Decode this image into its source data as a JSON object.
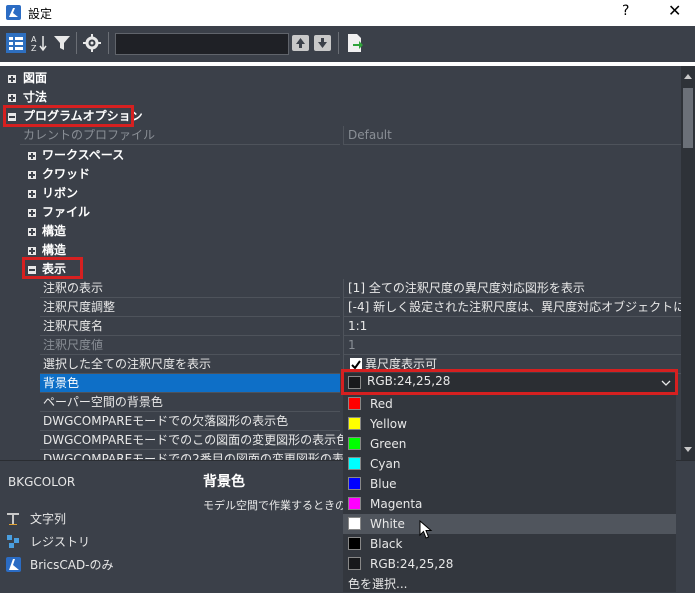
{
  "window": {
    "title": "設定",
    "help_label": "?",
    "close_label": "✕"
  },
  "toolbar": {
    "icons": [
      "categorized-view-icon",
      "sort-az-icon",
      "filter-icon",
      "settings-icon",
      "arrow-up-icon",
      "arrow-down-icon",
      "export-icon"
    ],
    "search": {
      "value": "",
      "placeholder": ""
    }
  },
  "tree": {
    "categories": [
      {
        "label": "図面",
        "expanded": false
      },
      {
        "label": "寸法",
        "expanded": false
      },
      {
        "label": "プログラムオプション",
        "expanded": true
      }
    ],
    "current_profile": {
      "name": "カレントのプロファイル",
      "value": "Default"
    },
    "subcategories": [
      {
        "label": "ワークスペース"
      },
      {
        "label": "クワッド"
      },
      {
        "label": "リボン"
      },
      {
        "label": "ファイル"
      },
      {
        "label": "構造"
      },
      {
        "label": "構造"
      },
      {
        "label": "表示"
      }
    ],
    "properties": [
      {
        "name": "注釈の表示",
        "value": "[1] 全ての注釈尺度の異尺度対応図形を表示"
      },
      {
        "name": "注釈尺度調整",
        "value": "[-4] 新しく設定された注釈尺度は、異尺度対応オブジェクトに追加されます"
      },
      {
        "name": "注釈尺度名",
        "value": "1:1"
      },
      {
        "name": "注釈尺度値",
        "value": "1"
      },
      {
        "name": "選択した全ての注釈尺度を表示",
        "value": "異尺度表示可"
      },
      {
        "name": "背景色",
        "value": "RGB:24,25,28"
      },
      {
        "name": "ペーパー空間の背景色",
        "value": ""
      },
      {
        "name": "DWGCOMPAREモードでの欠落図形の表示色",
        "value": ""
      },
      {
        "name": "DWGCOMPAREモードでのこの図面の変更図形の表示色",
        "value": ""
      },
      {
        "name": "DWGCOMPAREモードでの2番目の図面の変更図形の表示色",
        "value": ""
      }
    ]
  },
  "dropdown": {
    "current": "RGB:24,25,28",
    "current_color": "#18191c",
    "options": [
      {
        "label": "Red",
        "color": "#ff0000"
      },
      {
        "label": "Yellow",
        "color": "#ffff00"
      },
      {
        "label": "Green",
        "color": "#00ff00"
      },
      {
        "label": "Cyan",
        "color": "#00ffff"
      },
      {
        "label": "Blue",
        "color": "#0000ff"
      },
      {
        "label": "Magenta",
        "color": "#ff00ff"
      },
      {
        "label": "White",
        "color": "#ffffff"
      },
      {
        "label": "Black",
        "color": "#000000"
      },
      {
        "label": "RGB:24,25,28",
        "color": "#18191c"
      }
    ],
    "hovered": "White",
    "more_label": "色を選択..."
  },
  "bottom": {
    "variable": "BKGCOLOR",
    "heading": "背景色",
    "description": "モデル空間で作業するときの背",
    "links": [
      {
        "label": "文字列",
        "icon": "text-icon"
      },
      {
        "label": "レジストリ",
        "icon": "registry-icon"
      },
      {
        "label": "BricsCAD-のみ",
        "icon": "bricscad-icon"
      }
    ]
  },
  "colors": {
    "highlight": "#d62020",
    "selection": "#0e6fc7"
  }
}
